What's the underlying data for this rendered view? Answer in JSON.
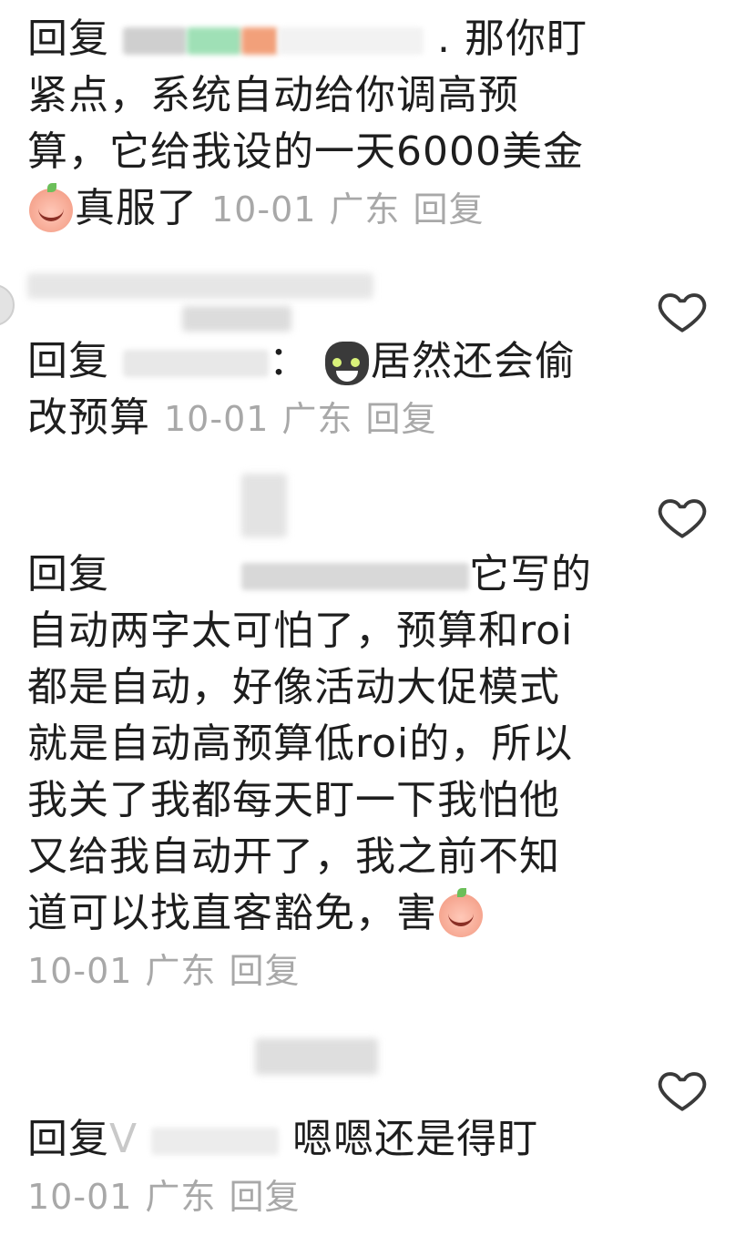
{
  "icons": {
    "heart": "heart-outline-icon",
    "emoji_laugh_cry": "peach-laugh-cry-emoji",
    "emoji_cat": "cat-emoji",
    "emoji_cry": "peach-cry-emoji"
  },
  "colors": {
    "text": "#1e1e1e",
    "meta": "#a8a8a8",
    "heart": "#3a3a3a"
  },
  "comments": [
    {
      "prefix": "回复",
      "text_a": ". 那你盯紧点，系统自动给你调高预算，它给我设的一天6000美金",
      "text_b": "真服了",
      "date": "10-01",
      "location": "广东",
      "reply": "回复"
    },
    {
      "prefix": "回复",
      "sep": "：",
      "text_b": "居然还会偷改预算",
      "date": "10-01",
      "location": "广东",
      "reply": "回复"
    },
    {
      "prefix": "回复",
      "text_a": "它写的自动两字太可怕了，预算和roi都是自动，好像活动大促模式就是自动高预算低roi的，所以我关了我都每天盯一下我怕他又给我自动开了，我之前不知道可以找直客豁免，害",
      "date": "10-01",
      "location": "广东",
      "reply": "回复"
    },
    {
      "prefix": "回复",
      "prefix_tail": "V",
      "text_a": "嗯嗯还是得盯",
      "date": "10-01",
      "location": "广东",
      "reply": "回复"
    }
  ]
}
